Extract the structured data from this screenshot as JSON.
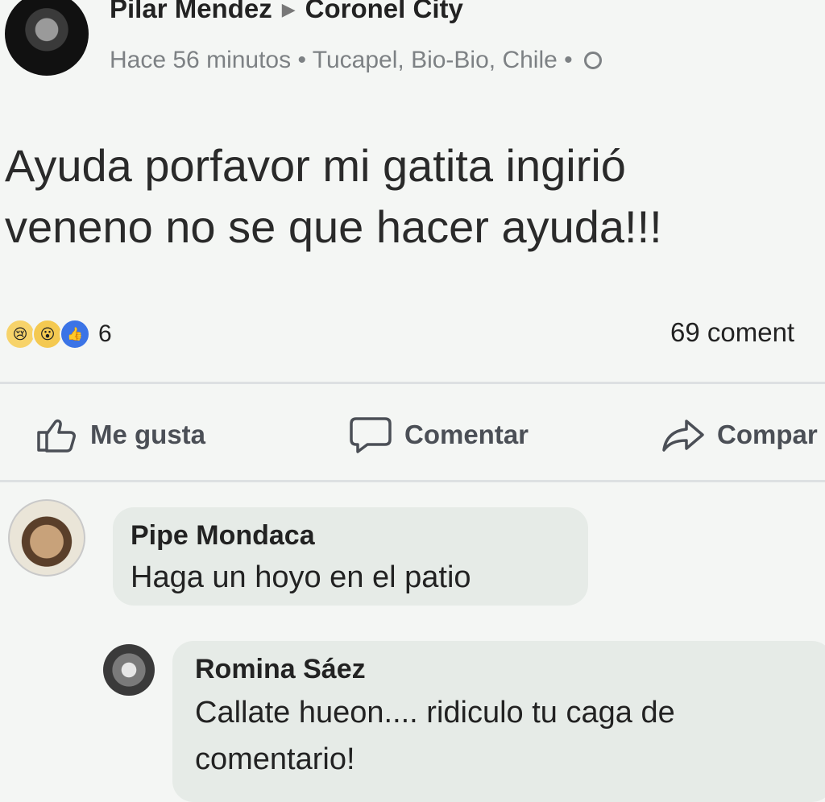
{
  "post": {
    "author": "Pilar Mendez",
    "group": "Coronel City",
    "time": "Hace 56 minutos",
    "location": "Tucapel, Bio-Bio, Chile",
    "separator": "•",
    "text": "Ayuda porfavor mi gatita ingirió\nveneno no se que hacer ayuda!!!",
    "reactions_count": "6",
    "comments_count": "69 coment"
  },
  "actions": {
    "like": "Me gusta",
    "comment": "Comentar",
    "share": "Compar"
  },
  "comments": [
    {
      "author": "Pipe Mondaca",
      "text": "Haga un hoyo en el patio"
    },
    {
      "author": "Romina Sáez",
      "text": "Callate hueon.... ridiculo tu caga de",
      "text2": "comentario!"
    }
  ],
  "icons": {
    "globe": "globe-icon",
    "like": "thumbs-up-icon",
    "comment": "speech-bubble-icon",
    "share": "share-arrow-icon"
  },
  "colors": {
    "background": "#f4f6f4",
    "bubble": "#e6ebe7",
    "like_blue": "#3b74e6",
    "reaction_yellow": "#f7d36a"
  }
}
